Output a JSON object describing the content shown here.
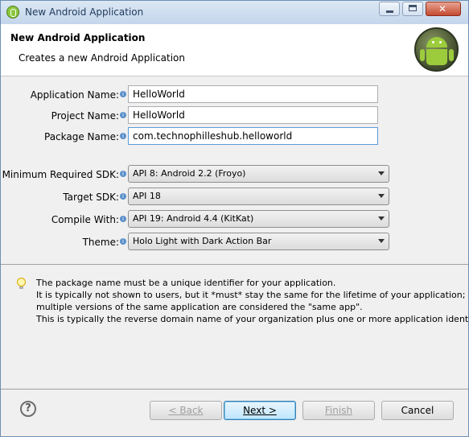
{
  "window": {
    "title": "New Android Application"
  },
  "header": {
    "title": "New Android Application",
    "subtitle": "Creates a new Android Application"
  },
  "form": {
    "app_name_label": "Application Name:",
    "app_name_value": "HelloWorld",
    "project_name_label": "Project Name:",
    "project_name_value": "HelloWorld",
    "package_name_label": "Package Name:",
    "package_name_value": "com.technophilleshub.helloworld",
    "min_sdk_label": "Minimum Required SDK:",
    "min_sdk_value": "API 8: Android 2.2 (Froyo)",
    "target_sdk_label": "Target SDK:",
    "target_sdk_value": "API 18",
    "compile_with_label": "Compile With:",
    "compile_with_value": "API 19: Android 4.4 (KitKat)",
    "theme_label": "Theme:",
    "theme_value": "Holo Light with Dark Action Bar"
  },
  "hint": {
    "line1": "The package name must be a unique identifier for your application.",
    "line2": "It is typically not shown to users, but it *must* stay the same for the lifetime of your application; it is",
    "line3": "multiple versions of the same application are considered the \"same app\".",
    "line4": "This is typically the reverse domain name of your organization plus one or more application identifi"
  },
  "buttons": {
    "back": "< Back",
    "next": "Next >",
    "finish": "Finish",
    "cancel": "Cancel"
  },
  "icons": {
    "app": "eclipse-icon",
    "logo": "android-logo",
    "info": "info-icon",
    "hint": "lightbulb-icon",
    "help": "help-icon"
  }
}
